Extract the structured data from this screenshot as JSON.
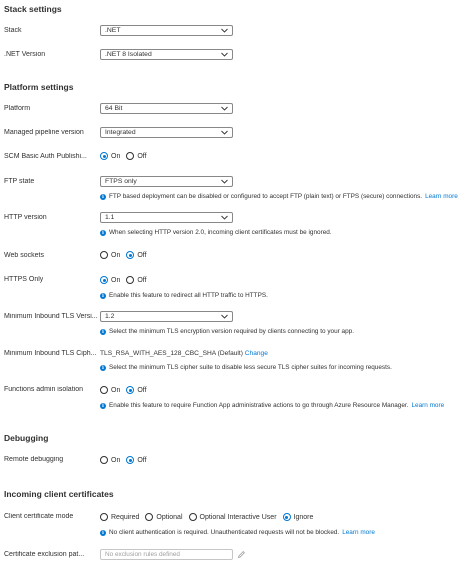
{
  "stack_settings": {
    "title": "Stack settings",
    "stack": {
      "label": "Stack",
      "value": ".NET"
    },
    "net_version": {
      "label": ".NET Version",
      "value": ".NET 8 Isolated"
    }
  },
  "platform_settings": {
    "title": "Platform settings",
    "platform": {
      "label": "Platform",
      "value": "64 Bit"
    },
    "pipeline": {
      "label": "Managed pipeline version",
      "value": "Integrated"
    },
    "scm_basic_auth": {
      "label": "SCM Basic Auth Publishi...",
      "on": "On",
      "off": "Off",
      "selected": "On"
    },
    "ftp_state": {
      "label": "FTP state",
      "value": "FTPS only",
      "info": "FTP based deployment can be disabled or configured to accept FTP (plain text) or FTPS (secure) connections.",
      "link": "Learn more"
    },
    "http_version": {
      "label": "HTTP version",
      "value": "1.1",
      "info": "When selecting HTTP version 2.0, incoming client certificates must be ignored."
    },
    "web_sockets": {
      "label": "Web sockets",
      "on": "On",
      "off": "Off",
      "selected": "Off"
    },
    "https_only": {
      "label": "HTTPS Only",
      "on": "On",
      "off": "Off",
      "selected": "On",
      "info": "Enable this feature to redirect all HTTP traffic to HTTPS."
    },
    "min_tls": {
      "label": "Minimum Inbound TLS Versi...",
      "value": "1.2",
      "info": "Select the minimum TLS encryption version required by clients connecting to your app."
    },
    "min_tls_cipher": {
      "label": "Minimum Inbound TLS Ciph...",
      "value": "TLS_RSA_WITH_AES_128_CBC_SHA (Default)",
      "link": "Change",
      "info": "Select the minimum TLS cipher suite to disable less secure TLS cipher suites for incoming requests."
    },
    "functions_admin": {
      "label": "Functions admin isolation",
      "on": "On",
      "off": "Off",
      "selected": "Off",
      "info": "Enable this feature to require Function App administrative actions to go through Azure Resource Manager.",
      "link": "Learn more"
    }
  },
  "debugging": {
    "title": "Debugging",
    "remote": {
      "label": "Remote debugging",
      "on": "On",
      "off": "Off",
      "selected": "Off"
    }
  },
  "client_certs": {
    "title": "Incoming client certificates",
    "mode": {
      "label": "Client certificate mode",
      "options": [
        "Required",
        "Optional",
        "Optional Interactive User",
        "Ignore"
      ],
      "selected": "Ignore",
      "info": "No client authentication is required. Unauthenticated requests will not be blocked.",
      "link": "Learn more"
    },
    "exclusion": {
      "label": "Certificate exclusion pat...",
      "placeholder": "No exclusion rules defined"
    }
  },
  "colors": {
    "accent": "#0078d4",
    "text": "#323130",
    "border": "#8a8886"
  },
  "icons": {
    "dropdown": "chevron-down-icon",
    "info": "info-icon",
    "edit": "pencil-icon"
  }
}
